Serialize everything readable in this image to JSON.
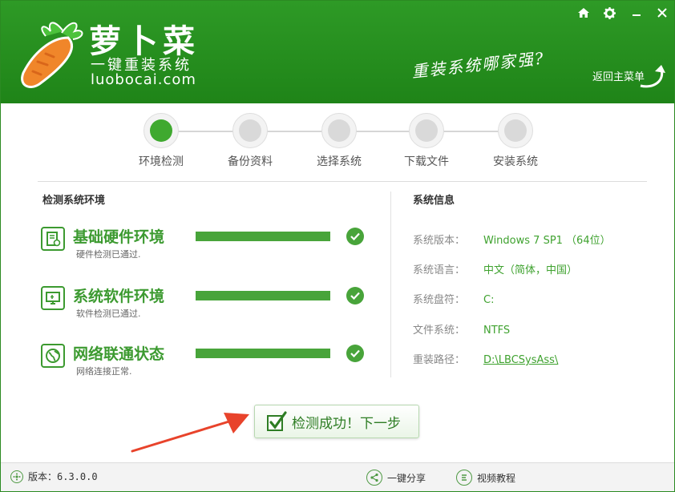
{
  "header": {
    "brand_name": "萝卜菜",
    "brand_sub": "一键重装系统",
    "brand_domain": "luobocai.com",
    "slogan": "重装系统哪家强?",
    "back_main_label": "返回主菜单",
    "window_buttons": [
      "home-icon",
      "gear-icon",
      "minimize-icon",
      "close-icon"
    ]
  },
  "steps": [
    {
      "label": "环境检测",
      "active": true
    },
    {
      "label": "备份资料",
      "active": false
    },
    {
      "label": "选择系统",
      "active": false
    },
    {
      "label": "下载文件",
      "active": false
    },
    {
      "label": "安装系统",
      "active": false
    }
  ],
  "left": {
    "title": "检测系统环境",
    "checks": [
      {
        "title": "基础硬件环境",
        "desc": "硬件检测已通过.",
        "icon": "hardware-icon",
        "progress": 1.0
      },
      {
        "title": "系统软件环境",
        "desc": "软件检测已通过.",
        "icon": "monitor-icon",
        "progress": 1.0
      },
      {
        "title": "网络联通状态",
        "desc": "网络连接正常.",
        "icon": "globe-icon",
        "progress": 1.0
      }
    ]
  },
  "right": {
    "title": "系统信息",
    "rows": [
      {
        "key": "系统版本：",
        "value": "Windows 7 SP1 （64位）"
      },
      {
        "key": "系统语言：",
        "value": "中文（简体，中国）"
      },
      {
        "key": "系统盘符：",
        "value": "C:"
      },
      {
        "key": "文件系统：",
        "value": "NTFS"
      },
      {
        "key": "重装路径：",
        "value": "D:\\LBCSysAss\\"
      }
    ]
  },
  "next_button": {
    "label": "检测成功！下一步"
  },
  "footer": {
    "version_label": "版本：6.3.0.0",
    "share_label": "一键分享",
    "video_label": "视频教程"
  },
  "colors": {
    "brand_green": "#229020",
    "accent_green": "#3fa22f",
    "arrow_red": "#e8432b"
  }
}
